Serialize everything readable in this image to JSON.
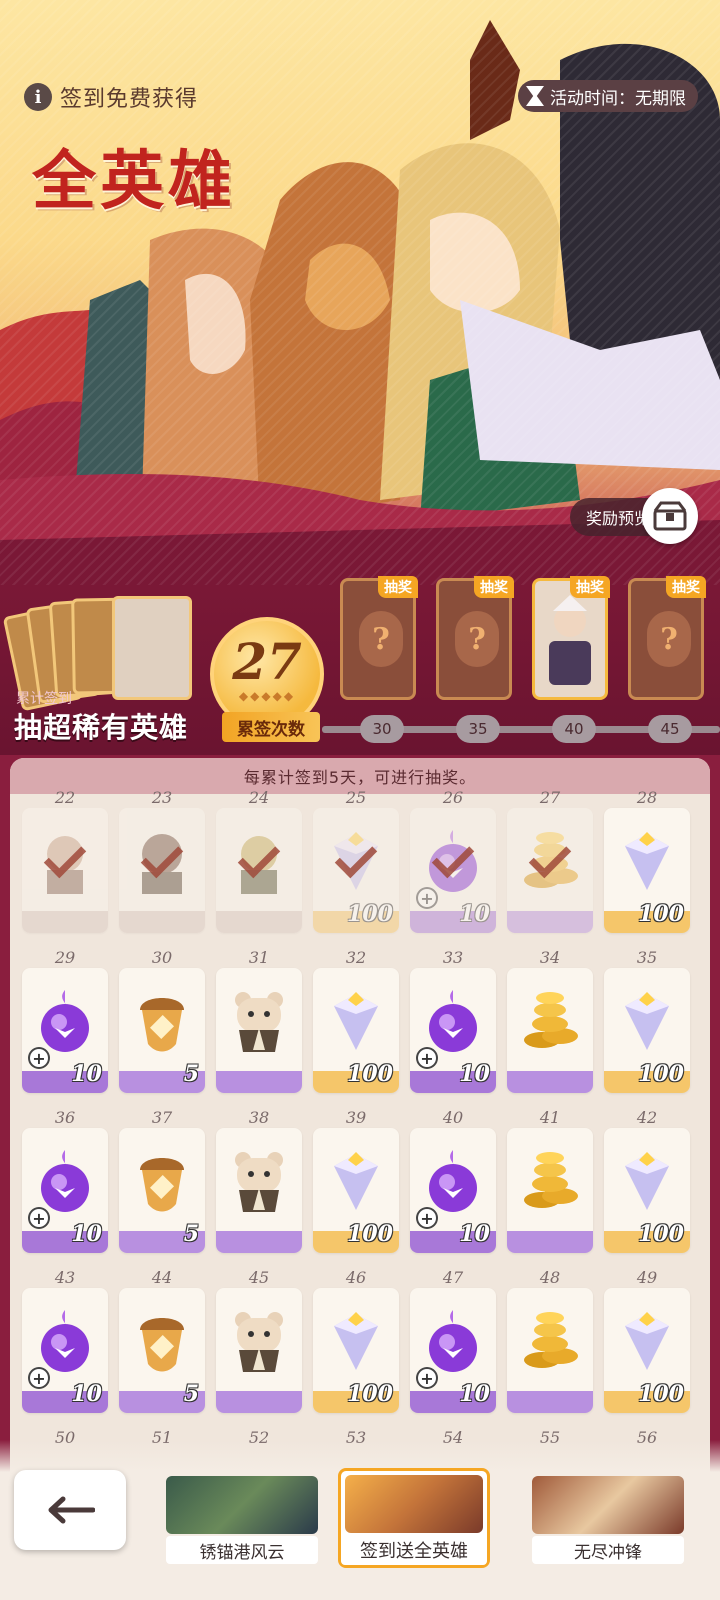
{
  "header": {
    "info_text": "签到免费获得",
    "title": "全英雄",
    "activity_time": "活动时间：无期限",
    "reward_preview": "奖励预览"
  },
  "draw": {
    "subtitle": "累计签到",
    "title": "抽超稀有英雄",
    "count": "27",
    "count_label": "累签次数",
    "prize_tag": "抽奖",
    "milestones": [
      "30",
      "35",
      "40",
      "45"
    ]
  },
  "board": {
    "notice": "每累计签到5天，可进行抽奖。",
    "rows": [
      [
        {
          "day": "22",
          "item": "hero",
          "qty": "",
          "claimed": true
        },
        {
          "day": "23",
          "item": "hero2",
          "qty": "",
          "claimed": true
        },
        {
          "day": "24",
          "item": "hero3",
          "qty": "",
          "claimed": true
        },
        {
          "day": "25",
          "item": "diamond",
          "qty": "100",
          "claimed": true
        },
        {
          "day": "26",
          "item": "orb",
          "qty": "10",
          "claimed": true
        },
        {
          "day": "27",
          "item": "coins",
          "qty": "",
          "claimed": true
        },
        {
          "day": "28",
          "item": "diamond",
          "qty": "100",
          "claimed": false
        }
      ],
      [
        {
          "day": "29",
          "item": "orb",
          "qty": "10",
          "claimed": false
        },
        {
          "day": "30",
          "item": "acorn",
          "qty": "5",
          "claimed": false
        },
        {
          "day": "31",
          "item": "bear",
          "qty": "",
          "claimed": false
        },
        {
          "day": "32",
          "item": "diamond",
          "qty": "100",
          "claimed": false
        },
        {
          "day": "33",
          "item": "orb",
          "qty": "10",
          "claimed": false
        },
        {
          "day": "34",
          "item": "coins",
          "qty": "",
          "claimed": false
        },
        {
          "day": "35",
          "item": "diamond",
          "qty": "100",
          "claimed": false
        }
      ],
      [
        {
          "day": "36",
          "item": "orb",
          "qty": "10",
          "claimed": false
        },
        {
          "day": "37",
          "item": "acorn",
          "qty": "5",
          "claimed": false
        },
        {
          "day": "38",
          "item": "bear",
          "qty": "",
          "claimed": false
        },
        {
          "day": "39",
          "item": "diamond",
          "qty": "100",
          "claimed": false
        },
        {
          "day": "40",
          "item": "orb",
          "qty": "10",
          "claimed": false
        },
        {
          "day": "41",
          "item": "coins",
          "qty": "",
          "claimed": false
        },
        {
          "day": "42",
          "item": "diamond",
          "qty": "100",
          "claimed": false
        }
      ],
      [
        {
          "day": "43",
          "item": "orb",
          "qty": "10",
          "claimed": false
        },
        {
          "day": "44",
          "item": "acorn",
          "qty": "5",
          "claimed": false
        },
        {
          "day": "45",
          "item": "bear",
          "qty": "",
          "claimed": false
        },
        {
          "day": "46",
          "item": "diamond",
          "qty": "100",
          "claimed": false
        },
        {
          "day": "47",
          "item": "orb",
          "qty": "10",
          "claimed": false
        },
        {
          "day": "48",
          "item": "coins",
          "qty": "",
          "claimed": false
        },
        {
          "day": "49",
          "item": "diamond",
          "qty": "100",
          "claimed": false
        }
      ],
      [
        {
          "day": "50"
        },
        {
          "day": "51"
        },
        {
          "day": "52"
        },
        {
          "day": "53"
        },
        {
          "day": "54"
        },
        {
          "day": "55"
        },
        {
          "day": "56"
        }
      ]
    ]
  },
  "tabs": [
    {
      "label": "锈锚港风云",
      "active": false
    },
    {
      "label": "签到送全英雄",
      "active": true
    },
    {
      "label": "无尽冲锋",
      "active": false
    }
  ],
  "colors": {
    "brand": "#c1241e",
    "accent": "#f5a623",
    "strip": "#7a1836"
  }
}
